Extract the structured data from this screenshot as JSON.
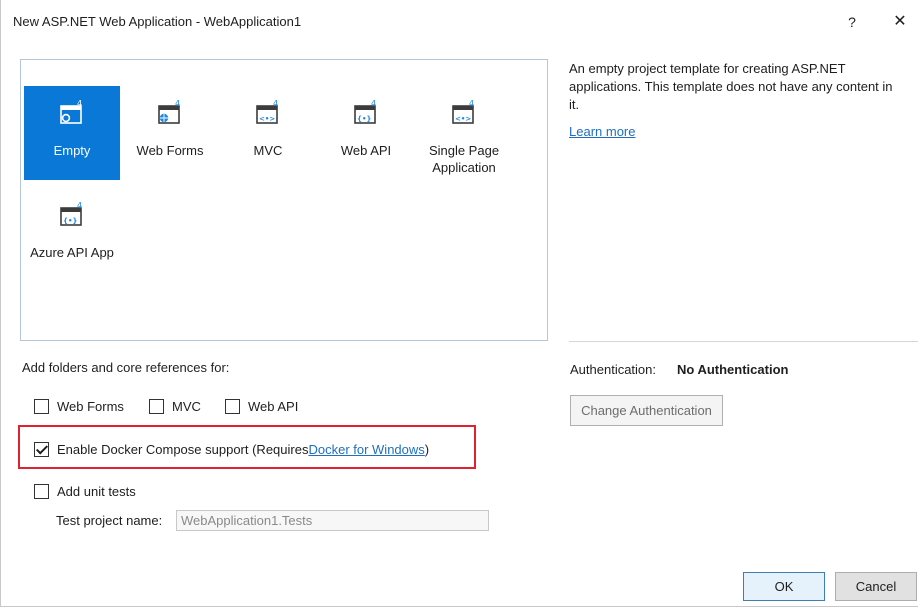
{
  "window": {
    "title": "New ASP.NET Web Application - WebApplication1",
    "help_label": "?",
    "close_label": "✕"
  },
  "templates": [
    {
      "label": "Empty",
      "icon": "empty-template-icon",
      "selected": true
    },
    {
      "label": "Web Forms",
      "icon": "web-forms-template-icon",
      "selected": false
    },
    {
      "label": "MVC",
      "icon": "mvc-template-icon",
      "selected": false
    },
    {
      "label": "Web API",
      "icon": "web-api-template-icon",
      "selected": false
    },
    {
      "label": "Single Page Application",
      "icon": "spa-template-icon",
      "selected": false
    },
    {
      "label": "Azure API App",
      "icon": "azure-api-app-template-icon",
      "selected": false
    }
  ],
  "icon_badge": "4",
  "description": {
    "text": "An empty project template for creating ASP.NET applications. This template does not have any content in it.",
    "learn_more": "Learn more"
  },
  "folders": {
    "label": "Add folders and core references for:",
    "options": [
      {
        "label": "Web Forms",
        "checked": false
      },
      {
        "label": "MVC",
        "checked": false
      },
      {
        "label": "Web API",
        "checked": false
      }
    ]
  },
  "docker": {
    "label": "Enable Docker Compose support (Requires ",
    "link": "Docker for Windows",
    "suffix": ")",
    "checked": true
  },
  "unit_tests": {
    "label": "Add unit tests",
    "checked": false,
    "project_name_label": "Test project name:",
    "project_name_value": "WebApplication1.Tests"
  },
  "auth": {
    "label": "Authentication:",
    "value": "No Authentication",
    "change_button": "Change Authentication"
  },
  "buttons": {
    "ok": "OK",
    "cancel": "Cancel"
  },
  "colors": {
    "accent": "#0a78d7",
    "link": "#1e6fc1",
    "highlight": "#e0212e"
  }
}
